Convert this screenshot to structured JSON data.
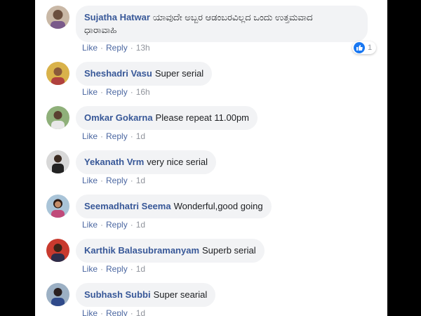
{
  "actions": {
    "like": "Like",
    "reply": "Reply",
    "dot": "·"
  },
  "comments": [
    {
      "author": "Sujatha Hatwar",
      "line1": "ಯಾವುದೇ ಅಬ್ಬರ ಆಡಂಬರವಿಲ್ಲದ ಒಂದು ಉತ್ತಮವಾದ",
      "line2": "ಧಾರಾವಾಹಿ",
      "time": "13h",
      "reactions": "1"
    },
    {
      "author": "Sheshadri Vasu",
      "text": "Super serial",
      "time": "16h"
    },
    {
      "author": "Omkar Gokarna",
      "text": "Please repeat 11.00pm",
      "time": "1d"
    },
    {
      "author": "Yekanath Vrm",
      "text": "very nice serial",
      "time": "1d"
    },
    {
      "author": "Seemadhatri Seema",
      "text": "Wonderful,good going",
      "time": "1d"
    },
    {
      "author": "Karthik Balasubramanyam",
      "text": "Superb serial",
      "time": "1d"
    },
    {
      "author": "Subhash Subbi",
      "text": "Super searial",
      "time": "1d"
    }
  ],
  "colors": {
    "author": "#385898",
    "link": "#4b67a1",
    "bubble": "#f2f3f5",
    "like_badge": "#1877f2"
  },
  "icons": {
    "reaction": "like-thumb-icon"
  }
}
